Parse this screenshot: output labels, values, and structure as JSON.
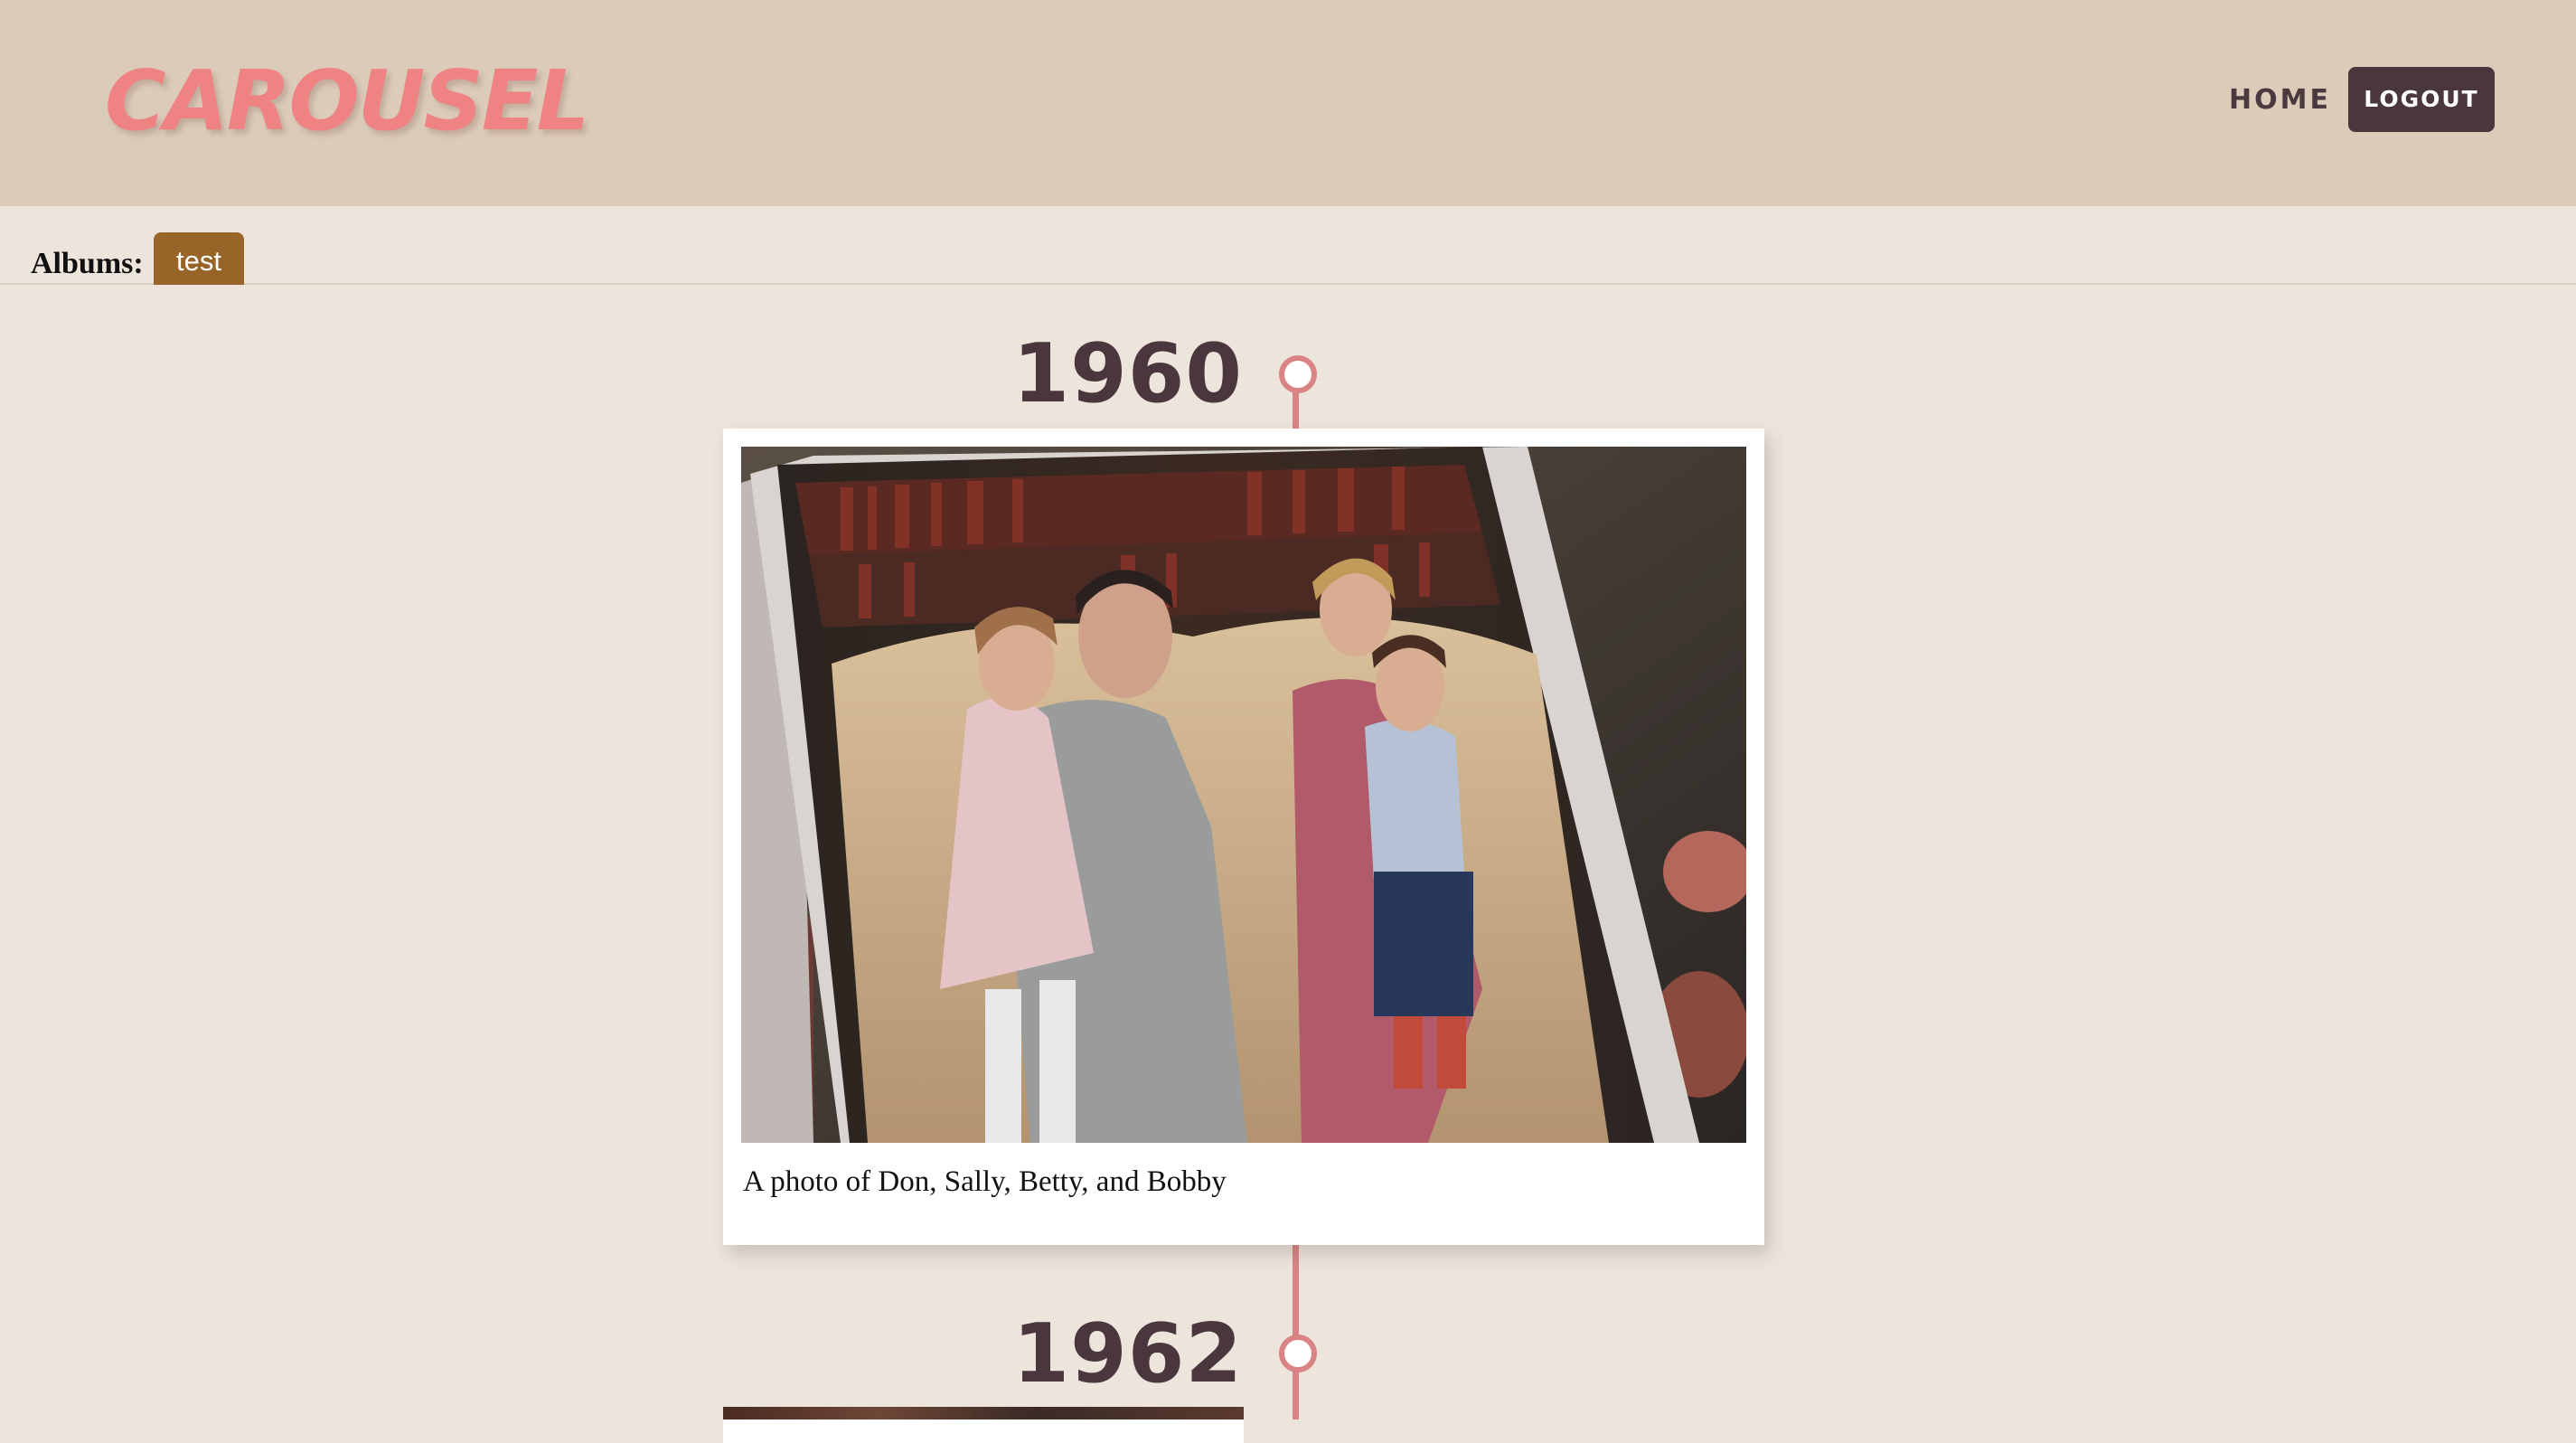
{
  "header": {
    "logo": "CAROUSEL",
    "nav": {
      "home": "HOME",
      "logout": "LOGOUT"
    }
  },
  "albums": {
    "label": "Albums:",
    "tabs": [
      {
        "label": "test",
        "active": true
      }
    ]
  },
  "timeline": {
    "entries": [
      {
        "year": "1960",
        "caption": "A photo of Don, Sally, Betty, and Bobby"
      },
      {
        "year": "1962"
      }
    ]
  },
  "colors": {
    "header_bg": "#dccbb9",
    "page_bg": "#ede4dc",
    "logo": "#ef8283",
    "accent_dark": "#4a363d",
    "timeline": "#d98384",
    "album_tab": "#986428"
  }
}
